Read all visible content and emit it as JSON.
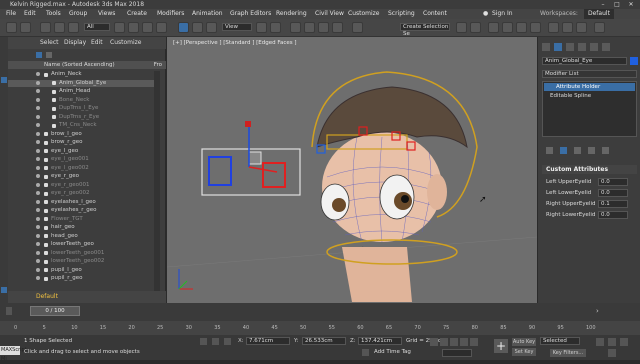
{
  "title": "Kelvin Rigged.max - Autodesk 3ds Max 2018",
  "menus": [
    "File",
    "Edit",
    "Tools",
    "Group",
    "Views",
    "Create",
    "Modifiers",
    "Animation",
    "Graph Editors",
    "Rendering",
    "Civil View",
    "Customize",
    "Scripting",
    "Content"
  ],
  "user": "Sign In",
  "workspaces": "Workspaces:",
  "workspace_value": "Default",
  "toolbar": {
    "selection_filter": "All",
    "view_dropdown": "View",
    "selection_set": "Create Selection Se"
  },
  "scene_explorer": {
    "tabs": [
      "Select",
      "Display",
      "Edit",
      "Customize"
    ],
    "header": "Name (Sorted Ascending)",
    "header_right": "Fro",
    "rows": [
      {
        "label": "Anim_Neck",
        "indent": 0,
        "state": "normal"
      },
      {
        "label": "Anim_Global_Eye",
        "indent": 1,
        "state": "selected"
      },
      {
        "label": "Anim_Head",
        "indent": 1,
        "state": "normal"
      },
      {
        "label": "Bone_Neck",
        "indent": 1,
        "state": "grey"
      },
      {
        "label": "DupTrns_l_Eye",
        "indent": 1,
        "state": "grey"
      },
      {
        "label": "DupTrns_r_Eye",
        "indent": 1,
        "state": "grey"
      },
      {
        "label": "TM_Cns_Neck",
        "indent": 1,
        "state": "grey"
      },
      {
        "label": "brow_l_geo",
        "indent": 0,
        "state": "normal"
      },
      {
        "label": "brow_r_geo",
        "indent": 0,
        "state": "normal"
      },
      {
        "label": "eye_l_geo",
        "indent": 0,
        "state": "normal"
      },
      {
        "label": "eye_l_geo001",
        "indent": 0,
        "state": "grey"
      },
      {
        "label": "eye_l_geo002",
        "indent": 0,
        "state": "grey"
      },
      {
        "label": "eye_r_geo",
        "indent": 0,
        "state": "normal"
      },
      {
        "label": "eye_r_geo001",
        "indent": 0,
        "state": "grey"
      },
      {
        "label": "eye_r_geo002",
        "indent": 0,
        "state": "grey"
      },
      {
        "label": "eyelashes_l_geo",
        "indent": 0,
        "state": "normal"
      },
      {
        "label": "eyelashes_r_geo",
        "indent": 0,
        "state": "normal"
      },
      {
        "label": "Flower_TGT",
        "indent": 0,
        "state": "grey"
      },
      {
        "label": "hair_geo",
        "indent": 0,
        "state": "normal"
      },
      {
        "label": "head_geo",
        "indent": 0,
        "state": "normal"
      },
      {
        "label": "lowerTeeth_geo",
        "indent": 0,
        "state": "normal"
      },
      {
        "label": "lowerTeeth_geo001",
        "indent": 0,
        "state": "grey"
      },
      {
        "label": "lowerTeeth_geo002",
        "indent": 0,
        "state": "grey"
      },
      {
        "label": "pupil_l_geo",
        "indent": 0,
        "state": "normal"
      },
      {
        "label": "pupil_r_geo",
        "indent": 0,
        "state": "normal"
      }
    ],
    "layer": "Default"
  },
  "viewport": {
    "label": "[+] [Perspective ] [Standard ] [Edged Faces ]"
  },
  "command_panel": {
    "object_name": "Anim_Global_Eye",
    "modifier_list": "Modifier List",
    "stack": [
      "Attribute Holder",
      "Editable Spline"
    ],
    "rollout_title": "Custom Attributes",
    "attributes": [
      {
        "label": "Left UpperEyelid",
        "value": "0.0"
      },
      {
        "label": "Left LowerEyelid",
        "value": "0.0"
      },
      {
        "label": "Right UpperEyelid",
        "value": "0.1"
      },
      {
        "label": "Right LowerEyelid",
        "value": "0.0"
      }
    ]
  },
  "timeline": {
    "frame": "0 / 100",
    "ticks": [
      "0",
      "5",
      "10",
      "15",
      "20",
      "25",
      "30",
      "35",
      "40",
      "45",
      "50",
      "55",
      "60",
      "65",
      "70",
      "75",
      "80",
      "85",
      "90",
      "95",
      "100"
    ]
  },
  "status": {
    "maxscript": "MAXScript Mi",
    "line1": "1 Shape Selected",
    "line2": "Click and drag to select and move objects",
    "x": "7.671cm",
    "y": "26.533cm",
    "z": "137.421cm",
    "grid": "Grid = 25.4cm",
    "add_time_tag": "Add Time Tag",
    "auto_key": "Auto Key",
    "set_key": "Set Key",
    "selected": "Selected",
    "key_filters": "Key Filters..."
  }
}
